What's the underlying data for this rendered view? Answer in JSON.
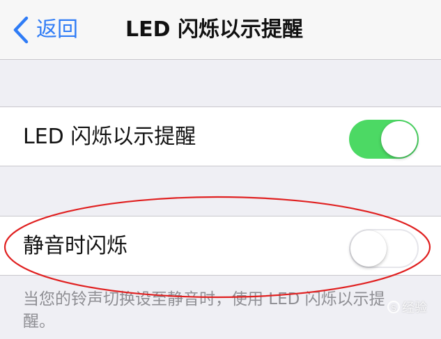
{
  "navbar": {
    "back_label": "返回",
    "back_icon": "chevron-left-icon",
    "title": "LED 闪烁以示提醒"
  },
  "settings": {
    "led_flash": {
      "label": "LED 闪烁以示提醒",
      "enabled": true
    },
    "flash_on_silent": {
      "label": "静音时闪烁",
      "enabled": false
    },
    "footer": "当您的铃声切换设至静音时，使用 LED 闪烁以示提醒。"
  },
  "watermark": {
    "text": "经验"
  },
  "colors": {
    "accent": "#2f7cf6",
    "toggle_on": "#4cd964",
    "annotation": "#e02020",
    "background": "#efeff4"
  }
}
